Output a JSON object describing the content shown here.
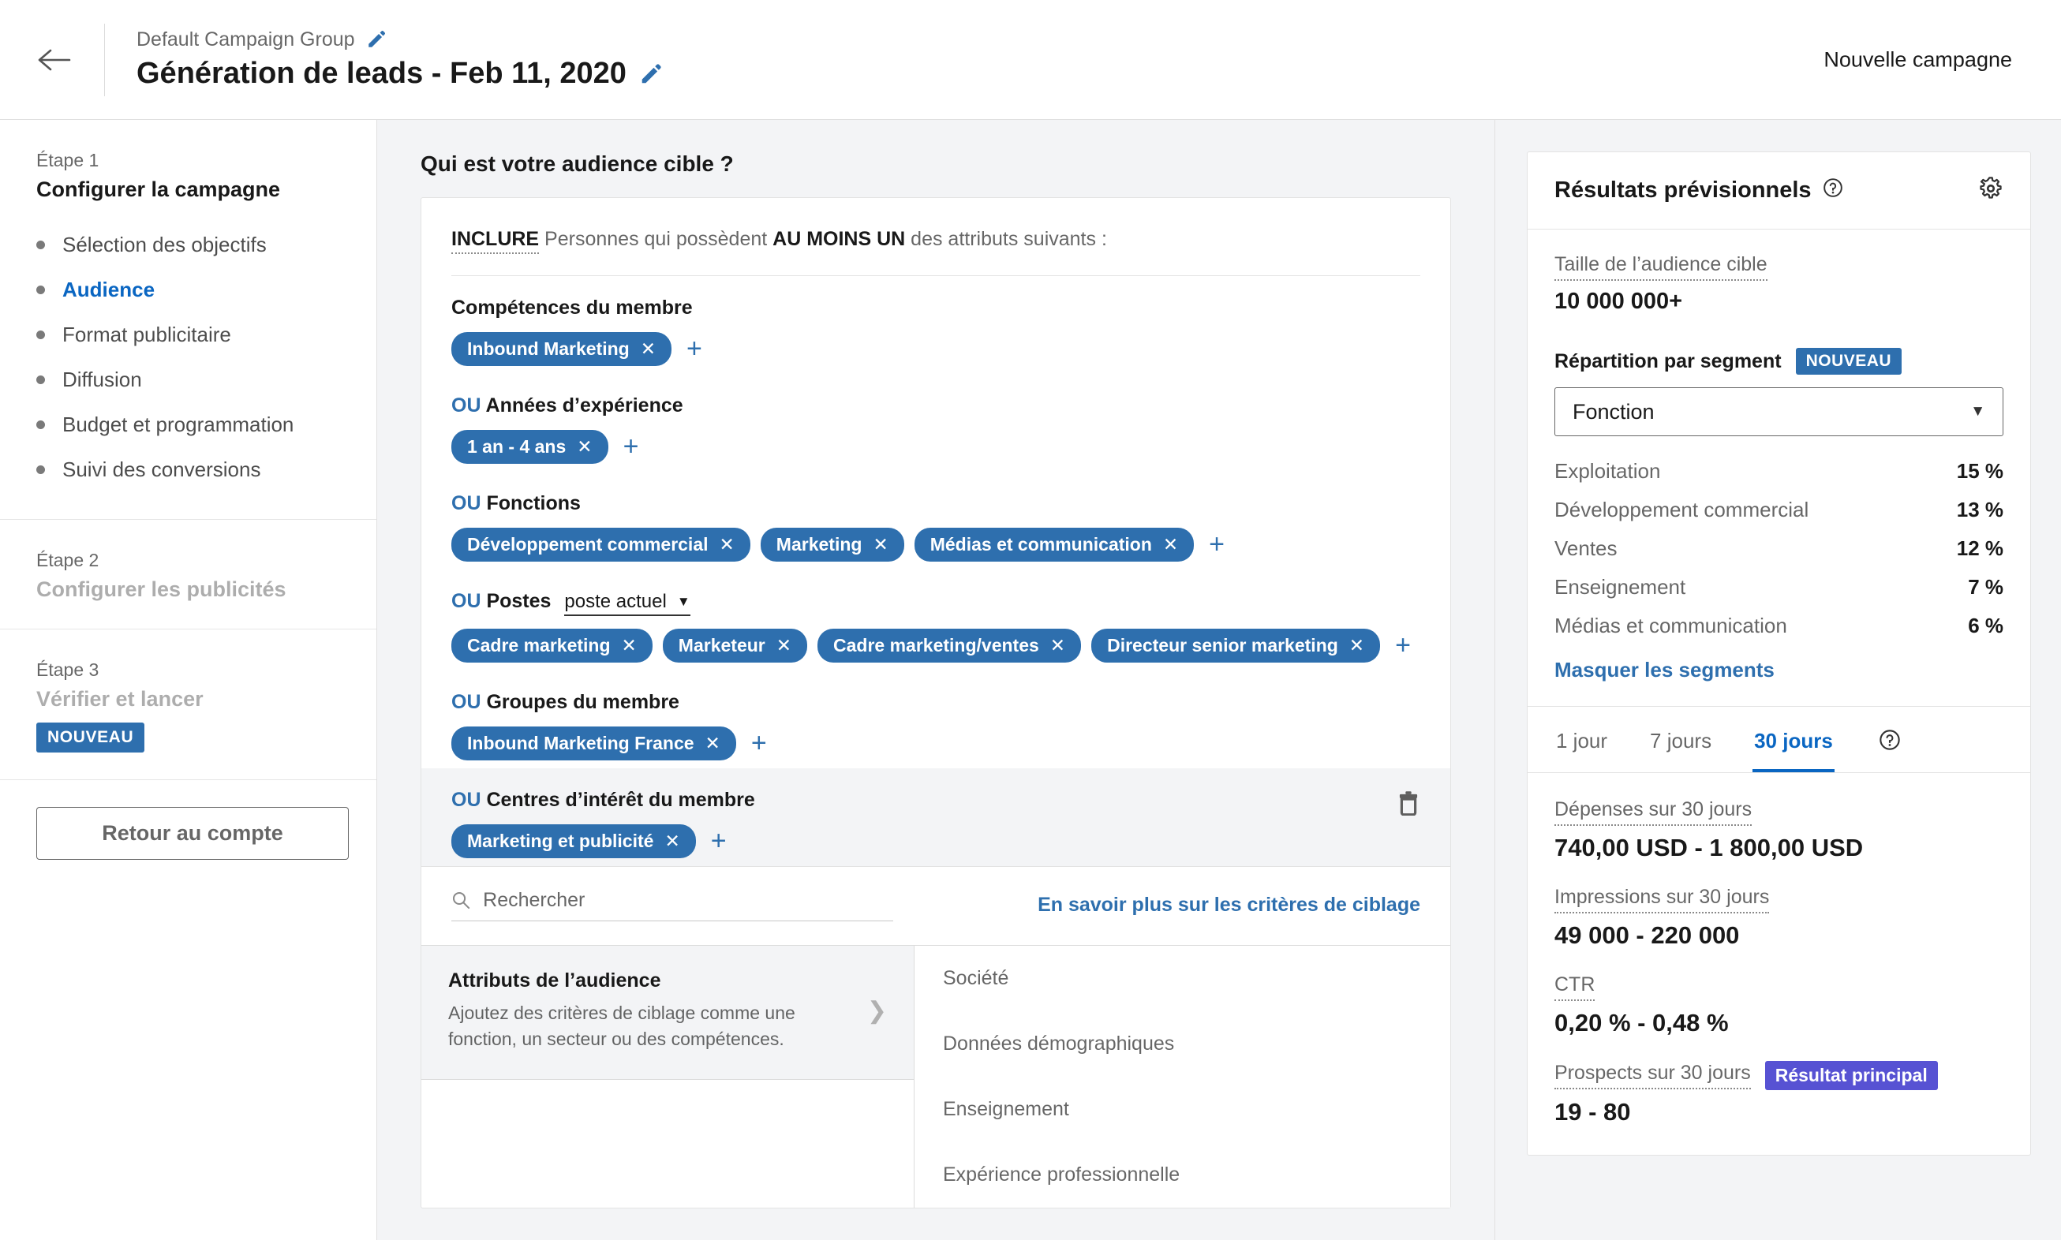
{
  "header": {
    "back_icon": "arrow-left-icon",
    "campaign_group": "Default Campaign Group",
    "campaign_name": "Génération de leads - Feb 11, 2020",
    "edit_icon": "pencil-icon",
    "new_campaign": "Nouvelle campagne"
  },
  "sidebar": {
    "step1": {
      "label": "Étape 1",
      "title": "Configurer la campagne",
      "items": [
        {
          "label": "Sélection des objectifs",
          "active": false
        },
        {
          "label": "Audience",
          "active": true
        },
        {
          "label": "Format publicitaire",
          "active": false
        },
        {
          "label": "Diffusion",
          "active": false
        },
        {
          "label": "Budget et programmation",
          "active": false
        },
        {
          "label": "Suivi des conversions",
          "active": false
        }
      ]
    },
    "step2": {
      "label": "Étape 2",
      "title": "Configurer les publicités"
    },
    "step3": {
      "label": "Étape 3",
      "title": "Vérifier et lancer",
      "badge": "NOUVEAU"
    },
    "return_button": "Retour au compte"
  },
  "main": {
    "heading": "Qui est votre audience cible ?",
    "include": {
      "keyword": "INCLURE",
      "text_before": " Personnes qui possèdent ",
      "emphasis": "AU MOINS UN",
      "text_after": " des attributs suivants :"
    },
    "facets": [
      {
        "or": "",
        "name": "Compétences du membre",
        "chips": [
          "Inbound Marketing"
        ],
        "hovered": false,
        "has_trash": false,
        "select": null
      },
      {
        "or": "OU",
        "name": "Années d’expérience",
        "chips": [
          "1 an - 4 ans"
        ],
        "hovered": false,
        "has_trash": false,
        "select": null
      },
      {
        "or": "OU",
        "name": "Fonctions",
        "chips": [
          "Développement commercial",
          "Marketing",
          "Médias et communication"
        ],
        "hovered": false,
        "has_trash": false,
        "select": null
      },
      {
        "or": "OU",
        "name": "Postes",
        "chips": [
          "Cadre marketing",
          "Marketeur",
          "Cadre marketing/ventes",
          "Directeur senior marketing"
        ],
        "hovered": false,
        "has_trash": false,
        "select": "poste actuel"
      },
      {
        "or": "OU",
        "name": "Groupes du membre",
        "chips": [
          "Inbound Marketing France"
        ],
        "hovered": false,
        "has_trash": false,
        "select": null
      },
      {
        "or": "OU",
        "name": "Centres d’intérêt du membre",
        "chips": [
          "Marketing et publicité"
        ],
        "hovered": true,
        "has_trash": true,
        "select": null
      }
    ],
    "chip_remove_glyph": "✕",
    "add_glyph": "+",
    "search_placeholder": "Rechercher",
    "search_value": "",
    "learn_more": "En savoir plus sur les critères de ciblage",
    "attributes": {
      "title": "Attributs de l’audience",
      "description": "Ajoutez des critères de ciblage comme une fonction, un secteur ou des compétences."
    },
    "categories": [
      "Société",
      "Données démographiques",
      "Enseignement",
      "Expérience professionnelle"
    ]
  },
  "forecast": {
    "title": "Résultats prévisionnels",
    "help_icon": "question-circle-icon",
    "settings_icon": "gear-icon",
    "audience_size_label": "Taille de l’audience cible",
    "audience_size_value": "10 000 000+",
    "segment_title": "Répartition par segment",
    "segment_badge": "NOUVEAU",
    "segment_selected": "Fonction",
    "segments": [
      {
        "name": "Exploitation",
        "pct": "15 %"
      },
      {
        "name": "Développement commercial",
        "pct": "13 %"
      },
      {
        "name": "Ventes",
        "pct": "12 %"
      },
      {
        "name": "Enseignement",
        "pct": "7 %"
      },
      {
        "name": "Médias et communication",
        "pct": "6 %"
      }
    ],
    "hide_segments": "Masquer les segments",
    "tabs": [
      {
        "label": "1 jour",
        "active": false
      },
      {
        "label": "7 jours",
        "active": false
      },
      {
        "label": "30 jours",
        "active": true
      }
    ],
    "metrics": [
      {
        "label": "Dépenses sur 30 jours",
        "value": "740,00 USD - 1 800,00 USD",
        "badge": null
      },
      {
        "label": "Impressions sur 30 jours",
        "value": "49 000 - 220 000",
        "badge": null
      },
      {
        "label": "CTR",
        "value": "0,20 % - 0,48 %",
        "badge": null
      },
      {
        "label": "Prospects sur 30 jours",
        "value": "19 - 80",
        "badge": "Résultat principal"
      }
    ]
  },
  "colors": {
    "accent": "#0a66c2",
    "chip": "#2e6fae",
    "key_result": "#5752d3"
  }
}
